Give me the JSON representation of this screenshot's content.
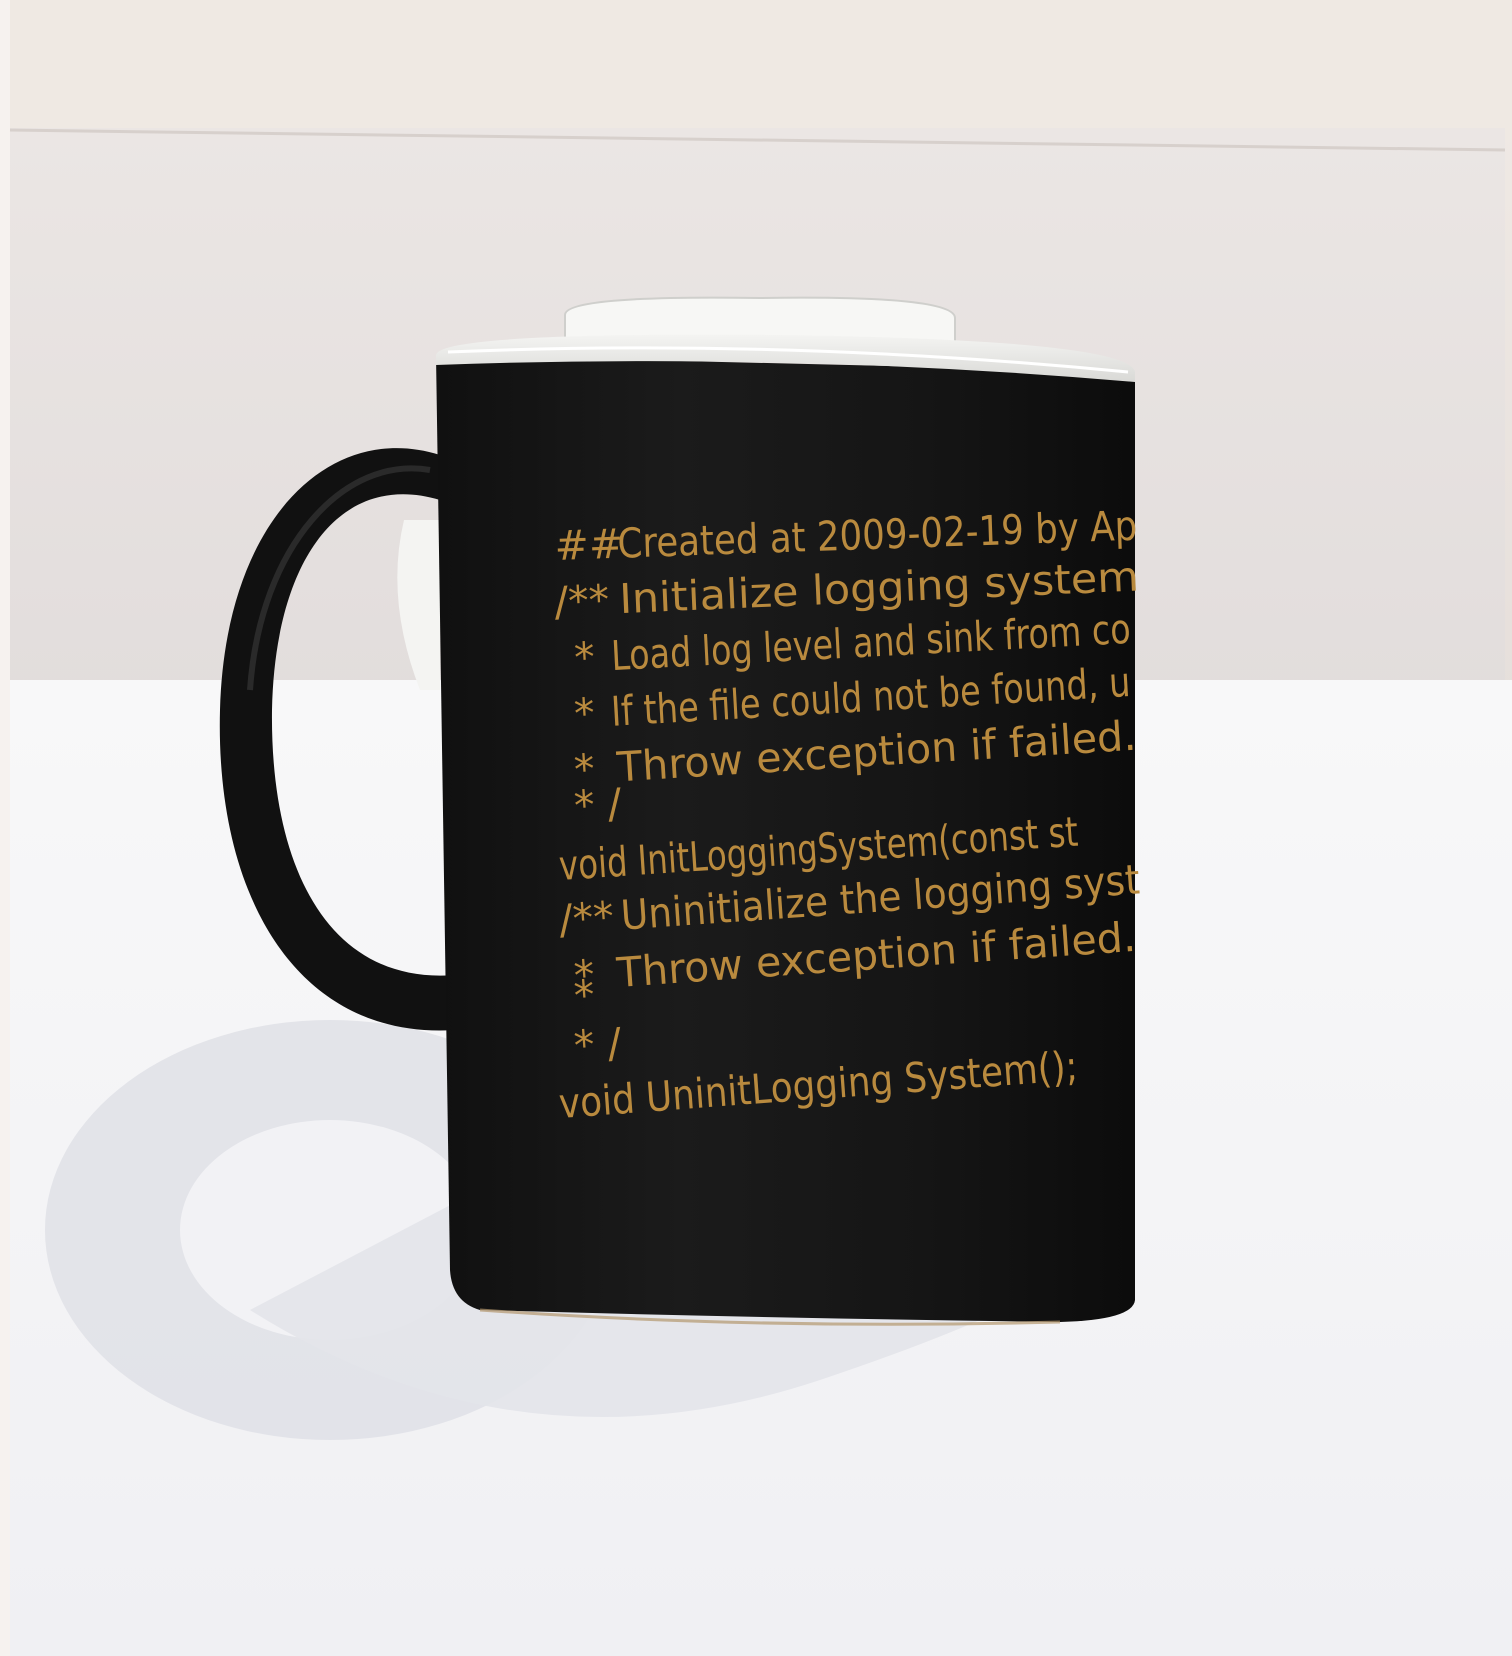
{
  "mug": {
    "body_color": "#151515",
    "print_color": "#b98a3e",
    "code_lines": [
      {
        "gutter": "##",
        "text": "Created at 2009-02-19 by Ap"
      },
      {
        "gutter": "/**",
        "text": "Initialize logging system"
      },
      {
        "gutter": "*",
        "text": "Load log level and sink from co"
      },
      {
        "gutter": "*",
        "text": "If the file could not be found, u"
      },
      {
        "gutter": "*",
        "text": "Throw exception if failed."
      },
      {
        "gutter": "* /",
        "text": ""
      },
      {
        "gutter": "",
        "text": "void InitLoggingSystem(const st"
      },
      {
        "gutter": "/**",
        "text": "Uninitialize the logging syst"
      },
      {
        "gutter": "*",
        "text": "Throw exception if failed."
      },
      {
        "gutter": "*",
        "text": ""
      },
      {
        "gutter": "* /",
        "text": ""
      },
      {
        "gutter": "",
        "text": "void UninitLogging System();"
      }
    ]
  },
  "scene": {
    "backdrop_color": "#e7e1dd",
    "table_color": "#f4f4f6",
    "shadow_color": "#d6d7df"
  }
}
